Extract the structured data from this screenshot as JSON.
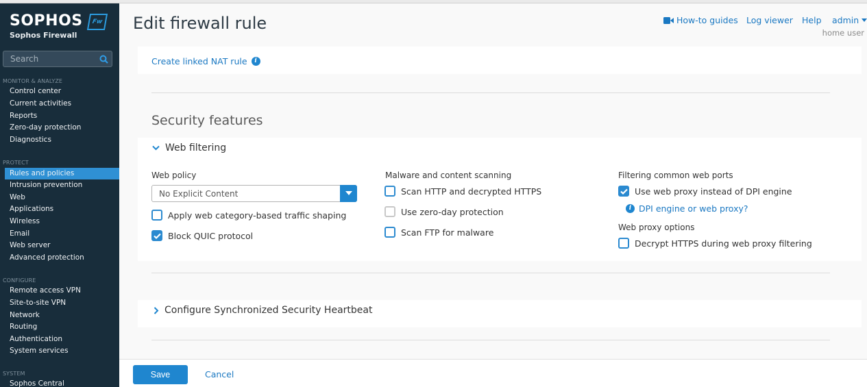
{
  "brand": {
    "logo": "SOPHOS",
    "badge": "Fw",
    "product": "Sophos Firewall",
    "accent": "#2f90d4"
  },
  "search": {
    "placeholder": "Search"
  },
  "sidebar": {
    "sections": [
      {
        "title": "MONITOR & ANALYZE",
        "items": [
          "Control center",
          "Current activities",
          "Reports",
          "Zero-day protection",
          "Diagnostics"
        ]
      },
      {
        "title": "PROTECT",
        "items": [
          "Rules and policies",
          "Intrusion prevention",
          "Web",
          "Applications",
          "Wireless",
          "Email",
          "Web server",
          "Advanced protection"
        ]
      },
      {
        "title": "CONFIGURE",
        "items": [
          "Remote access VPN",
          "Site-to-site VPN",
          "Network",
          "Routing",
          "Authentication",
          "System services"
        ]
      },
      {
        "title": "SYSTEM",
        "items": [
          "Sophos Central"
        ]
      }
    ],
    "active_item": "Rules and policies"
  },
  "header": {
    "title": "Edit firewall rule",
    "links": {
      "howto": "How-to guides",
      "log": "Log viewer",
      "help": "Help",
      "user": "admin"
    },
    "user_role": "home user"
  },
  "main": {
    "nat_link": "Create linked NAT rule",
    "security_title": "Security features",
    "web_filtering": {
      "title": "Web filtering",
      "expanded": true,
      "web_policy_label": "Web policy",
      "web_policy_value": "No Explicit Content",
      "apply_shaping": {
        "label": "Apply web category-based traffic shaping",
        "checked": false
      },
      "block_quic": {
        "label": "Block QUIC protocol",
        "checked": true
      },
      "malware_label": "Malware and content scanning",
      "scan_http": {
        "label": "Scan HTTP and decrypted HTTPS",
        "checked": false
      },
      "zero_day": {
        "label": "Use zero-day protection",
        "checked": false,
        "disabled": true
      },
      "scan_ftp": {
        "label": "Scan FTP for malware",
        "checked": false
      },
      "ports_label": "Filtering common web ports",
      "use_proxy": {
        "label": "Use web proxy instead of DPI engine",
        "checked": true
      },
      "dpi_link": "DPI engine or web proxy?",
      "proxy_options_label": "Web proxy options",
      "decrypt_https": {
        "label": "Decrypt HTTPS during web proxy filtering",
        "checked": false
      }
    },
    "heartbeat": {
      "title": "Configure Synchronized Security Heartbeat",
      "expanded": false
    }
  },
  "footer": {
    "save": "Save",
    "cancel": "Cancel"
  }
}
